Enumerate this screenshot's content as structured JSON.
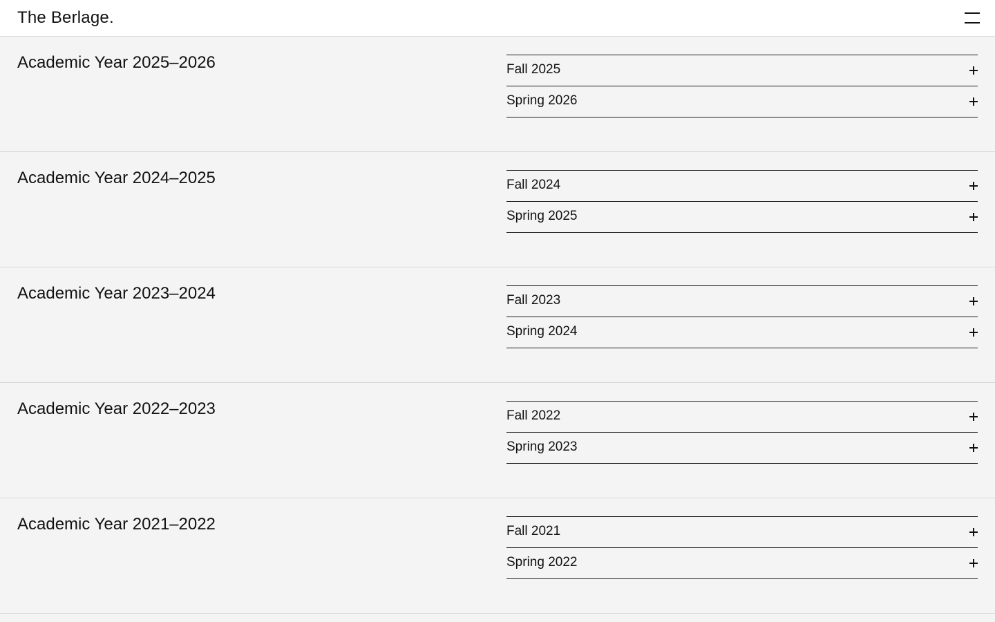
{
  "header": {
    "logo": "The Berlage.",
    "menu_icon": "hamburger-menu-icon"
  },
  "years": [
    {
      "title": "Academic Year 2025–2026",
      "semesters": [
        {
          "label": "Fall 2025",
          "icon": "plus-icon"
        },
        {
          "label": "Spring 2026",
          "icon": "plus-icon"
        }
      ]
    },
    {
      "title": "Academic Year 2024–2025",
      "semesters": [
        {
          "label": "Fall 2024",
          "icon": "plus-icon"
        },
        {
          "label": "Spring 2025",
          "icon": "plus-icon"
        }
      ]
    },
    {
      "title": "Academic Year 2023–2024",
      "semesters": [
        {
          "label": "Fall 2023",
          "icon": "plus-icon"
        },
        {
          "label": "Spring 2024",
          "icon": "plus-icon"
        }
      ]
    },
    {
      "title": "Academic Year 2022–2023",
      "semesters": [
        {
          "label": "Fall 2022",
          "icon": "plus-icon"
        },
        {
          "label": "Spring 2023",
          "icon": "plus-icon"
        }
      ]
    },
    {
      "title": "Academic Year 2021–2022",
      "semesters": [
        {
          "label": "Fall 2021",
          "icon": "plus-icon"
        },
        {
          "label": "Spring 2022",
          "icon": "plus-icon"
        }
      ]
    }
  ],
  "colors": {
    "background": "#f4f4f4",
    "header_background": "#ffffff",
    "text": "#111111",
    "divider": "#d8d8d8"
  }
}
